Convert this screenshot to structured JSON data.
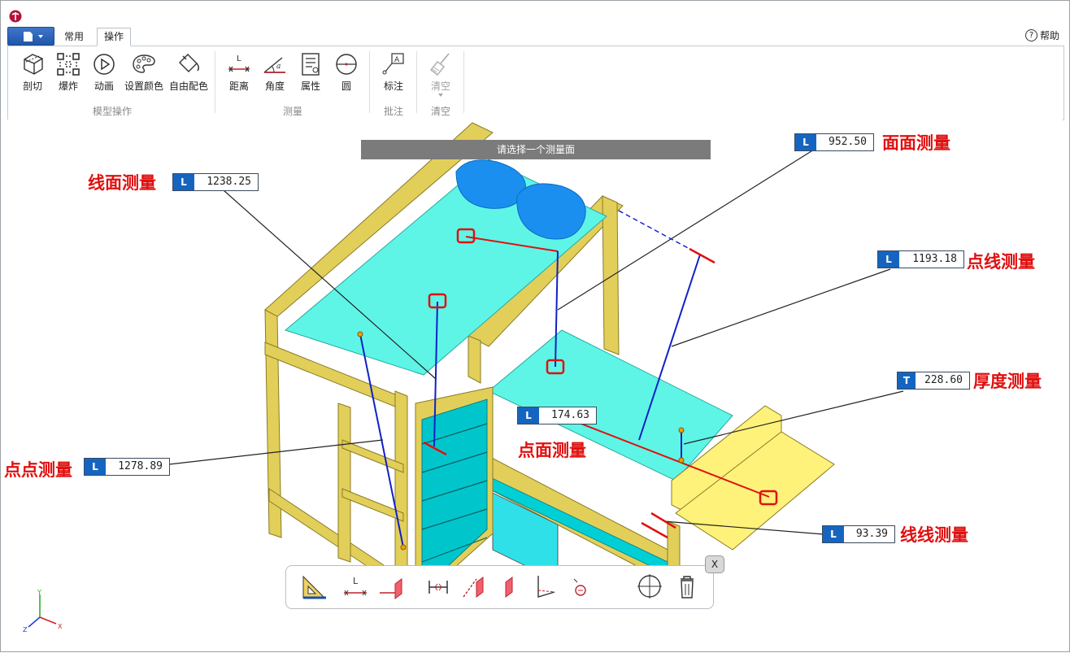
{
  "ribbon": {
    "tabs": [
      {
        "label": "常用",
        "active": false
      },
      {
        "label": "操作",
        "active": true
      }
    ],
    "help_label": "帮助",
    "tools": {
      "section": "剖切",
      "explode": "爆炸",
      "animation": "动画",
      "set_color": "设置颜色",
      "free_color": "自由配色",
      "distance": "距离",
      "angle": "角度",
      "properties": "属性",
      "circle": "圆",
      "annotate": "标注",
      "clear": "清空"
    },
    "groups": {
      "model_ops": "模型操作",
      "measure": "测量",
      "annotation": "批注",
      "clear": "清空"
    }
  },
  "viewport": {
    "hint": "请选择一个测量面",
    "measurements": [
      {
        "tag": "L",
        "value": "952.50",
        "label": "面面测量"
      },
      {
        "tag": "L",
        "value": "1238.25",
        "label": "线面测量"
      },
      {
        "tag": "L",
        "value": "1193.18",
        "label": "点线测量"
      },
      {
        "tag": "T",
        "value": "228.60",
        "label": "厚度测量"
      },
      {
        "tag": "L",
        "value": "174.63",
        "label": "点面测量"
      },
      {
        "tag": "L",
        "value": "1278.89",
        "label": "点点测量"
      },
      {
        "tag": "L",
        "value": "93.39",
        "label": "线线测量"
      }
    ],
    "axes": {
      "x": "X",
      "y": "Y",
      "z": "Z"
    },
    "close_label": "X",
    "measure_toolbar": {
      "distance_icon_label": "L"
    }
  },
  "colors": {
    "accent": "#1565c0",
    "annotation_red": "#e01010",
    "bed_frame": "#e2cf5a",
    "mattress": "#5ef5e6",
    "pillow": "#1a8ff0"
  }
}
